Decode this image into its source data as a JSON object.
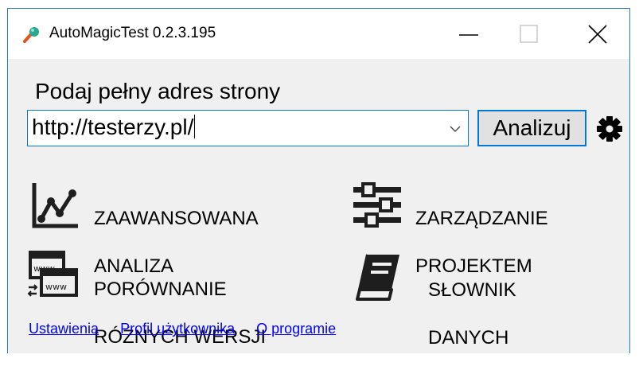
{
  "window": {
    "title": "AutoMagicTest 0.2.3.195"
  },
  "form": {
    "prompt": "Podaj pełny adres strony",
    "url_value": "http://testerzy.pl/",
    "analyze_label": "Analizuj"
  },
  "features": [
    {
      "line1": "ZAAWANSOWANA",
      "line2": "ANALIZA",
      "icon": "line-chart-icon"
    },
    {
      "line1": "ZARZĄDZANIE",
      "line2": "PROJEKTEM",
      "icon": "sliders-icon"
    },
    {
      "line1": "PORÓWNANIE",
      "line2": "RÓŻNYCH WERSJI",
      "icon": "compare-versions-icon"
    },
    {
      "line1": "SŁOWNIK",
      "line2": "DANYCH",
      "icon": "book-icon"
    }
  ],
  "links": [
    "Ustawienia",
    "Profil użytkownika",
    "O programie"
  ]
}
